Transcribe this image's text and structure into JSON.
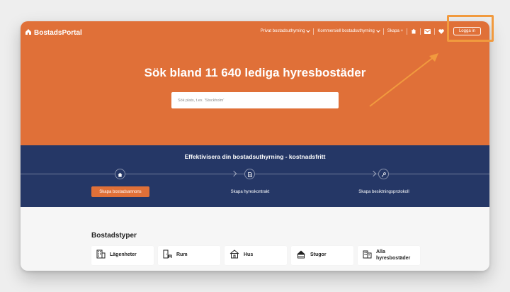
{
  "nav": {
    "logo": "BostadsPortal",
    "menu": [
      {
        "label": "Privat bostadsuthyrning",
        "chevron": true
      },
      {
        "label": "Kommersiell bostadsuthyrning",
        "chevron": true
      },
      {
        "label": "Skapa +",
        "chevron": false
      }
    ],
    "icons": [
      "home-icon",
      "mail-icon",
      "heart-icon"
    ],
    "login": "Logga in"
  },
  "hero": {
    "title": "Sök bland 11 640 lediga hyresbostäder",
    "search_placeholder": "Sök plats, t.ex. 'Stockholm'"
  },
  "band": {
    "title": "Effektivisera din bostadsuthyrning - kostnadsfritt",
    "steps": [
      {
        "icon": "home-icon",
        "label": "Skapa bostadsannons"
      },
      {
        "icon": "document-icon",
        "label": "Skapa hyreskontrakt"
      },
      {
        "icon": "key-icon",
        "label": "Skapa besiktningsprotokoll"
      }
    ]
  },
  "types": {
    "title": "Bostadstyper",
    "items": [
      {
        "icon": "apartment-icon",
        "label": "Lägenheter"
      },
      {
        "icon": "room-icon",
        "label": "Rum"
      },
      {
        "icon": "house-icon",
        "label": "Hus"
      },
      {
        "icon": "cabin-icon",
        "label": "Stugor"
      },
      {
        "icon": "buildings-icon",
        "label": "Alla hyresbostäder"
      }
    ]
  },
  "colors": {
    "brand_orange": "#e07038",
    "navy": "#253766",
    "highlight": "#f19a3e"
  }
}
